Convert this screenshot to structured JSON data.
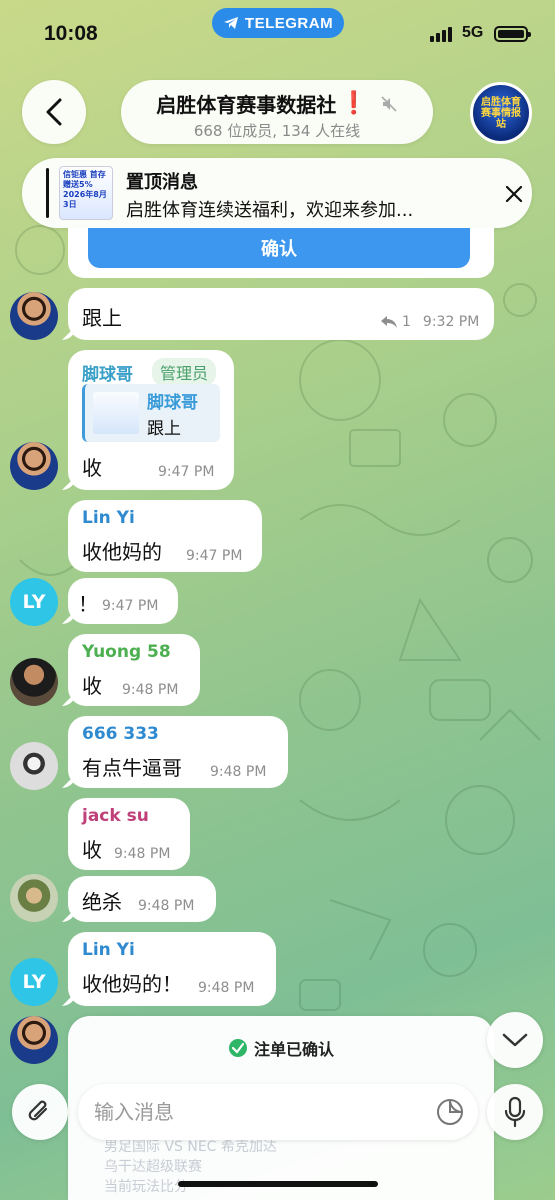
{
  "status": {
    "time": "10:08",
    "app_pill": "TELEGRAM",
    "network": "5G"
  },
  "header": {
    "title": "启胜体育赛事数据社",
    "title_mark": "❗",
    "subtitle": "668 位成员, 134 人在线",
    "avatar_text": "启胜体育赛事情报站"
  },
  "pinned": {
    "title": "置顶消息",
    "text": "启胜体育连续送福利，欢迎来参加...",
    "thumb_text": "信钜惠 首存赠送5% 2026年8月3日"
  },
  "confirm_card": {
    "button": "确认"
  },
  "messages": [
    {
      "id": "m1",
      "text": "跟上",
      "replies": "1",
      "time": "9:32 PM",
      "avatar": "messi"
    },
    {
      "id": "m2",
      "sender": "脚球哥",
      "badge": "管理员",
      "reply_sender": "脚球哥",
      "reply_text": "跟上",
      "text": "收",
      "time": "9:47 PM",
      "avatar": "messi"
    },
    {
      "id": "m3",
      "sender": "Lin Yi",
      "text": "收他妈的",
      "time": "9:47 PM"
    },
    {
      "id": "m4",
      "text": "！",
      "time": "9:47 PM",
      "avatar_text": "LY"
    },
    {
      "id": "m5",
      "sender": "Yuong 58",
      "text": "收",
      "time": "9:48 PM"
    },
    {
      "id": "m6",
      "sender": "666 333",
      "text": "有点牛逼哥",
      "time": "9:48 PM"
    },
    {
      "id": "m7",
      "sender": "jack su",
      "text": "收",
      "time": "9:48 PM"
    },
    {
      "id": "m8",
      "text": "绝杀",
      "time": "9:48 PM"
    },
    {
      "id": "m9",
      "sender": "Lin Yi",
      "text": "收他妈的！",
      "time": "9:48 PM",
      "avatar_text": "LY"
    }
  ],
  "bottom_card": {
    "confirmed": "注单已确认",
    "faded_1": "男足国际 VS NEC 希克加达",
    "faded_2": "乌干达超级联赛",
    "faded_3": "当前玩法比分"
  },
  "composer": {
    "placeholder": "输入消息"
  },
  "colors": {
    "accent": "#3d97ee",
    "sender_cyan": "#3aa0c8",
    "sender_green": "#4caf50",
    "sender_blue": "#2f8ad0",
    "sender_pink": "#c0407a",
    "admin_green": "#4aa06b"
  },
  "icons": [
    "back-chevron-icon",
    "mute-icon",
    "close-icon",
    "reply-arrow-icon",
    "paperclip-icon",
    "sticker-icon",
    "microphone-icon",
    "chevron-down-icon",
    "check-icon",
    "telegram-plane-icon"
  ]
}
